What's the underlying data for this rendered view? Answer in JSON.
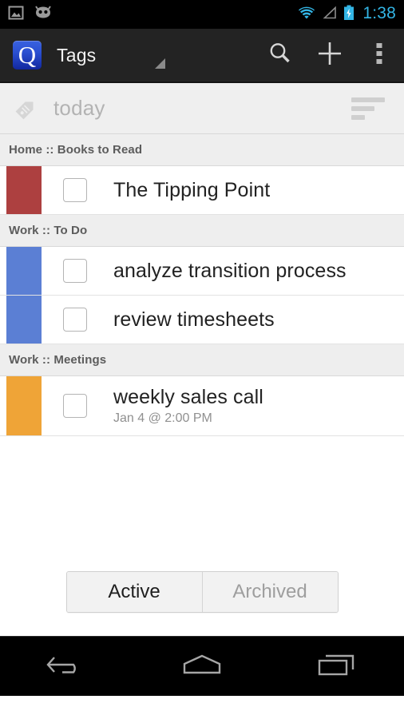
{
  "status_bar": {
    "icons": [
      "gallery-icon",
      "cyanogenmod-icon",
      "wifi-icon",
      "cell-signal-icon",
      "battery-charging-icon"
    ],
    "time": "1:38",
    "accent_color": "#33b5e5"
  },
  "action_bar": {
    "app_icon_letter": "Q",
    "title": "Tags",
    "actions": [
      {
        "name": "search",
        "icon": "search-icon"
      },
      {
        "name": "add",
        "icon": "plus-icon"
      },
      {
        "name": "overflow",
        "icon": "overflow-menu-icon"
      }
    ]
  },
  "filter_bar": {
    "icon": "tag-icon",
    "label": "today",
    "sort_icon": "sort-icon"
  },
  "list": {
    "sections": [
      {
        "header": "Home :: Books to Read",
        "items": [
          {
            "title": "The Tipping Point",
            "subtitle": "",
            "color": "#ad4040",
            "checked": false
          }
        ]
      },
      {
        "header": "Work :: To Do",
        "items": [
          {
            "title": "analyze transition process",
            "subtitle": "",
            "color": "#5b7fd4",
            "checked": false
          },
          {
            "title": "review timesheets",
            "subtitle": "",
            "color": "#5b7fd4",
            "checked": false
          }
        ]
      },
      {
        "header": "Work :: Meetings",
        "items": [
          {
            "title": "weekly sales call",
            "subtitle": "Jan 4 @ 2:00 PM",
            "color": "#efa437",
            "checked": false
          }
        ]
      }
    ]
  },
  "footer": {
    "segmented": [
      {
        "label": "Active",
        "selected": true
      },
      {
        "label": "Archived",
        "selected": false
      }
    ]
  },
  "nav_bar": {
    "buttons": [
      {
        "name": "back",
        "icon": "back-arrow-icon"
      },
      {
        "name": "home",
        "icon": "home-icon"
      },
      {
        "name": "recents",
        "icon": "recents-icon"
      }
    ]
  }
}
